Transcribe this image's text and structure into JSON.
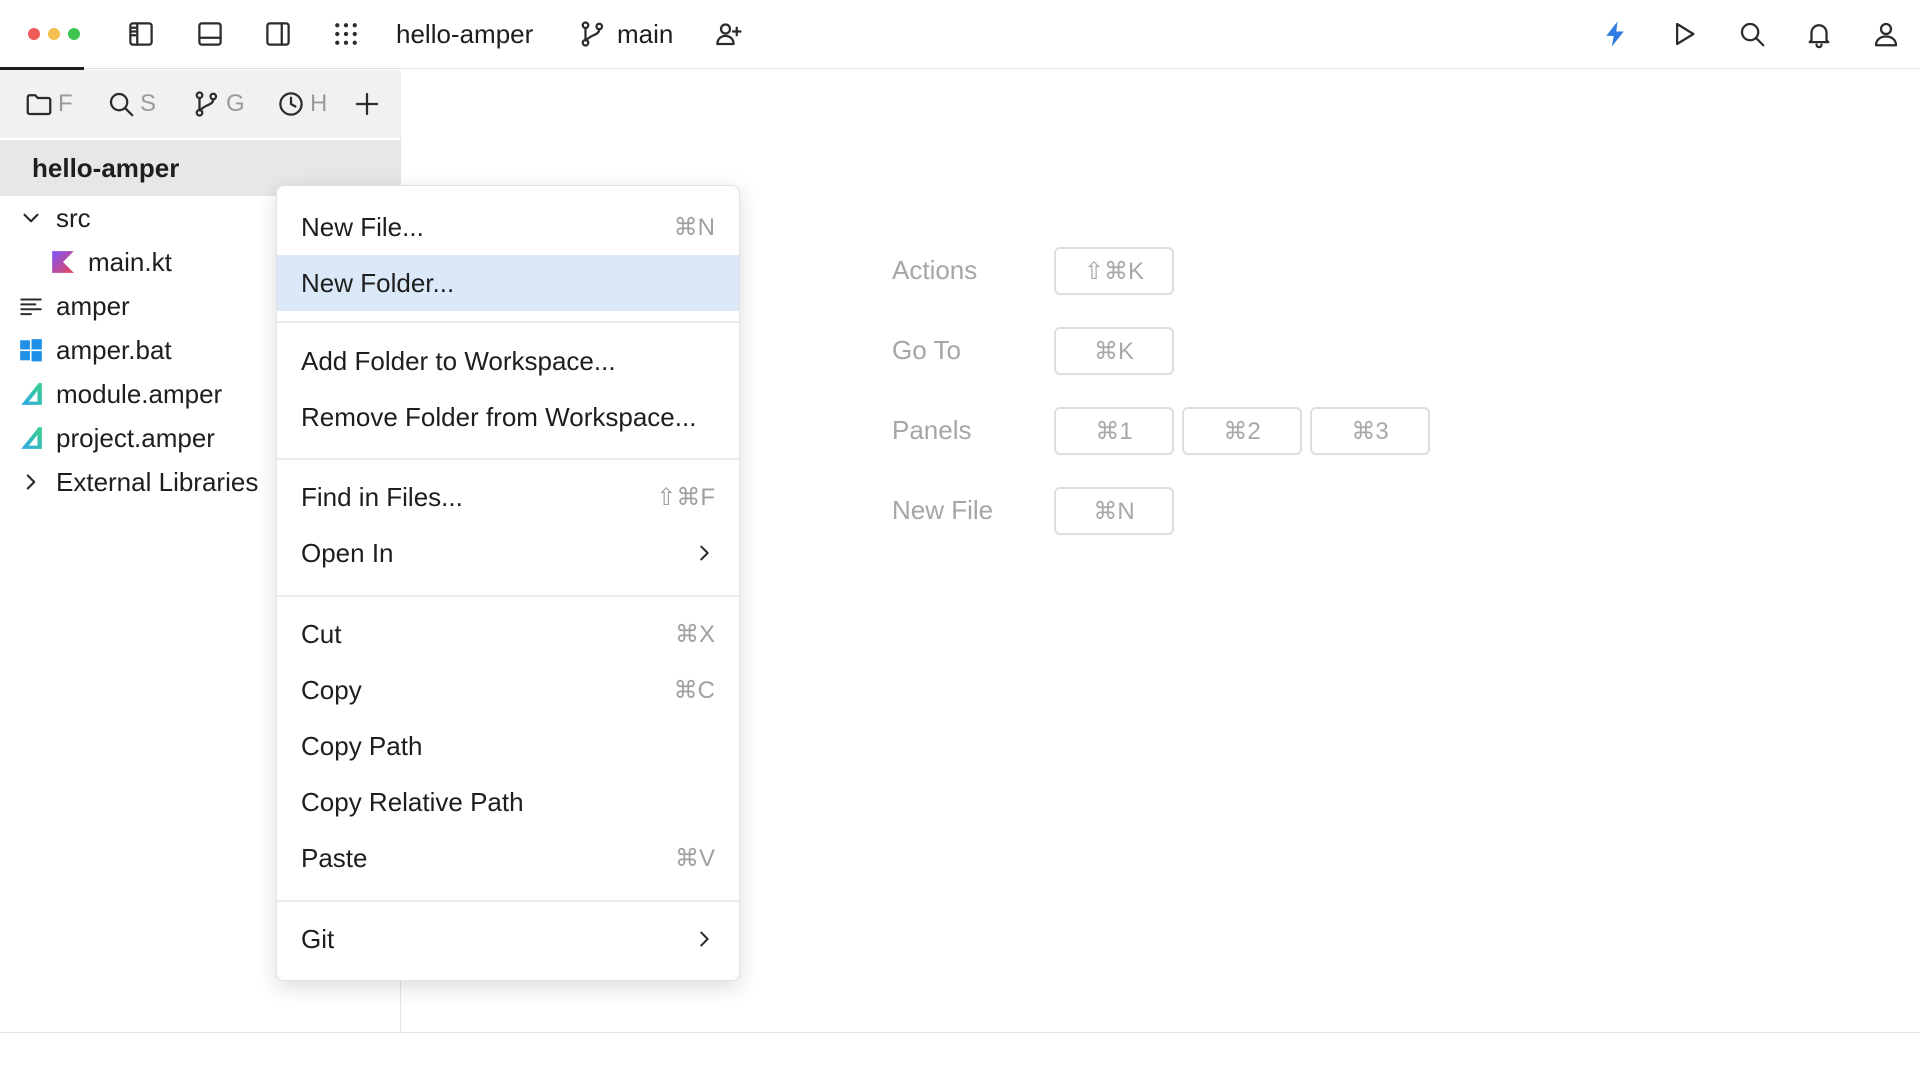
{
  "titlebar": {
    "project_name": "hello-amper",
    "branch": "main",
    "colors": {
      "close": "#ef5b58",
      "minimize": "#f4bf4f",
      "maximize": "#3fc351",
      "accent": "#2f7de1"
    }
  },
  "panel_tabs": [
    {
      "icon": "folder-icon",
      "label": "F"
    },
    {
      "icon": "search-icon",
      "label": "S"
    },
    {
      "icon": "git-branch-icon",
      "label": "G"
    },
    {
      "icon": "clock-icon",
      "label": "H"
    }
  ],
  "project": {
    "root": "hello-amper",
    "tree": [
      {
        "label": "src",
        "icon": "chevron-down-icon"
      },
      {
        "label": "main.kt",
        "icon": "kotlin-icon"
      },
      {
        "label": "amper",
        "icon": "text-lines-icon"
      },
      {
        "label": "amper.bat",
        "icon": "windows-icon"
      },
      {
        "label": "module.amper",
        "icon": "amper-icon"
      },
      {
        "label": "project.amper",
        "icon": "amper-icon"
      },
      {
        "label": "External Libraries",
        "icon": "chevron-right-icon"
      }
    ]
  },
  "context_menu": {
    "items": [
      {
        "label": "New File...",
        "shortcut": "⌘N"
      },
      {
        "label": "New Folder...",
        "shortcut": ""
      },
      {
        "label": "Add Folder to Workspace...",
        "shortcut": ""
      },
      {
        "label": "Remove Folder from Workspace...",
        "shortcut": ""
      },
      {
        "label": "Find in Files...",
        "shortcut": "⇧⌘F"
      },
      {
        "label": "Open In",
        "shortcut": ""
      },
      {
        "label": "Cut",
        "shortcut": "⌘X"
      },
      {
        "label": "Copy",
        "shortcut": "⌘C"
      },
      {
        "label": "Copy Path",
        "shortcut": ""
      },
      {
        "label": "Copy Relative Path",
        "shortcut": ""
      },
      {
        "label": "Paste",
        "shortcut": "⌘V"
      },
      {
        "label": "Git",
        "shortcut": ""
      }
    ]
  },
  "welcome": {
    "shortcuts": [
      {
        "label": "Actions",
        "keys": [
          "⇧⌘K"
        ]
      },
      {
        "label": "Go To",
        "keys": [
          "⌘K"
        ]
      },
      {
        "label": "Panels",
        "keys": [
          "⌘1",
          "⌘2",
          "⌘3"
        ]
      },
      {
        "label": "New File",
        "keys": [
          "⌘N"
        ]
      }
    ]
  }
}
